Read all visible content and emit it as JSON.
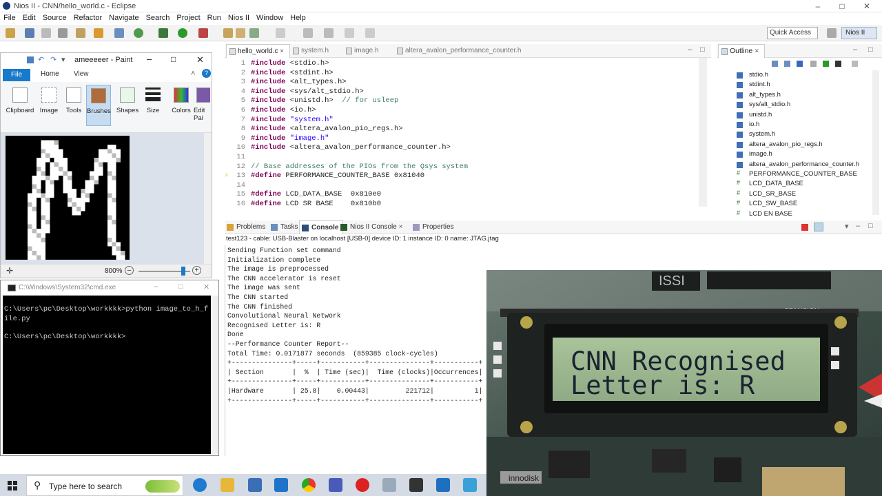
{
  "window": {
    "title": "Nios II - CNN/hello_world.c - Eclipse"
  },
  "menu": [
    "File",
    "Edit",
    "Source",
    "Refactor",
    "Navigate",
    "Search",
    "Project",
    "Run",
    "Nios II",
    "Window",
    "Help"
  ],
  "toolbar": {
    "quick_access": "Quick Access",
    "perspective": "Nios II"
  },
  "editor": {
    "tabs": [
      "hello_world.c",
      "system.h",
      "image.h",
      "altera_avalon_performance_counter.h"
    ],
    "lines": [
      {
        "n": "1",
        "pre": "#include",
        "arg": "<stdio.h>"
      },
      {
        "n": "2",
        "pre": "#include",
        "arg": "<stdint.h>"
      },
      {
        "n": "3",
        "pre": "#include",
        "arg": "<alt_types.h>"
      },
      {
        "n": "4",
        "pre": "#include",
        "arg": "<sys/alt_stdio.h>"
      },
      {
        "n": "5",
        "pre": "#include",
        "arg": "<unistd.h>",
        "comment": "// for usleep"
      },
      {
        "n": "6",
        "pre": "#include",
        "arg": "<io.h>"
      },
      {
        "n": "7",
        "pre": "#include",
        "arg": "\"system.h\""
      },
      {
        "n": "8",
        "pre": "#include",
        "arg": "<altera_avalon_pio_regs.h>"
      },
      {
        "n": "9",
        "pre": "#include",
        "arg": "\"image.h\""
      },
      {
        "n": "10",
        "pre": "#include",
        "arg": "<altera_avalon_performance_counter.h>"
      },
      {
        "n": "11",
        "pre": "",
        "arg": ""
      },
      {
        "n": "12",
        "pre": "",
        "arg": "",
        "comment": "// Base addresses of the PIOs from the Qsys system"
      },
      {
        "n": "13",
        "pre": "#define",
        "arg": "PERFORMANCE_COUNTER_BASE 0x81040"
      },
      {
        "n": "14",
        "pre": "",
        "arg": ""
      },
      {
        "n": "15",
        "pre": "#define",
        "arg": "LCD_DATA_BASE  0x810e0"
      },
      {
        "n": "16",
        "pre": "#define",
        "arg": "LCD SR BASE    0x810b0"
      }
    ]
  },
  "outline": {
    "title": "Outline",
    "items": [
      "stdio.h",
      "stdint.h",
      "alt_types.h",
      "sys/alt_stdio.h",
      "unistd.h",
      "io.h",
      "system.h",
      "altera_avalon_pio_regs.h",
      "image.h",
      "altera_avalon_performance_counter.h",
      "PERFORMANCE_COUNTER_BASE",
      "LCD_DATA_BASE",
      "LCD_SR_BASE",
      "LCD_SW_BASE",
      "LCD EN BASE"
    ]
  },
  "console": {
    "tabs": [
      "Problems",
      "Tasks",
      "Console",
      "Nios II Console",
      "Properties"
    ],
    "description": "test123 - cable: USB-Blaster on localhost [USB-0] device ID: 1 instance ID: 0 name: JTAG.jtag",
    "lines": [
      "Sending Function set command",
      "Initialization complete",
      "The image is preprocessed",
      "The CNN accelerator is reset",
      "The image was sent",
      "The CNN started",
      "The CNN finished",
      "Convolutional Neural Network",
      "Recognised Letter is: R",
      "Done",
      "--Performance Counter Report--",
      "Total Time: 0.0171877 seconds  (859385 clock-cycles)",
      "+---------------+-----+-----------+---------------+-----------+",
      "| Section       |  %  | Time (sec)|  Time (clocks)|Occurrences|",
      "+---------------+-----+-----------+---------------+-----------+",
      "|Hardware       | 25.8|    0.00443|         221712|          1|",
      "+---------------+-----+-----------+---------------+-----------+"
    ]
  },
  "paint": {
    "title": "ameeeeer - Paint",
    "file_tab": "File",
    "tabs": [
      "Home",
      "View"
    ],
    "groups": [
      "Clipboard",
      "Image",
      "Tools",
      "Brushes",
      "Shapes",
      "Size",
      "Colors",
      "Edit Pai"
    ],
    "zoom": "800%"
  },
  "cmd": {
    "title": "C:\\Windows\\System32\\cmd.exe",
    "line1": "C:\\Users\\pc\\Desktop\\workkkk>python image_to_h_f",
    "line2": "ile.py",
    "line3": "C:\\Users\\pc\\Desktop\\workkkk>"
  },
  "lcd": {
    "line1": "CNN Recognised",
    "line2": "Letter is: R",
    "brand": "SPANSION",
    "chip": "ISSI",
    "board": "innodisk"
  },
  "taskbar": {
    "search_placeholder": "Type here to search"
  }
}
